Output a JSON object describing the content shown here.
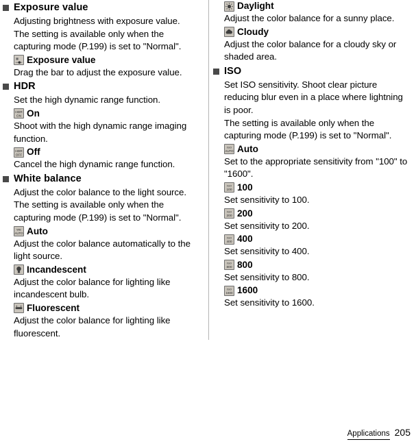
{
  "footer": {
    "section_label": "Applications",
    "page_number": "205"
  },
  "left_column": {
    "sections": [
      {
        "title": "Exposure value",
        "paragraphs": [
          "Adjusting brightness with exposure value.",
          "The setting is available only when the capturing mode (P.199) is set to \"Normal\"."
        ],
        "options": [
          {
            "icon": "exposure-value-icon",
            "label": "Exposure value",
            "desc": "Drag the bar to adjust the exposure value."
          }
        ]
      },
      {
        "title": "HDR",
        "paragraphs": [
          "Set the high dynamic range function."
        ],
        "options": [
          {
            "icon": "hdr-on-icon",
            "label": "On",
            "desc": "Shoot with the high dynamic range imaging function."
          },
          {
            "icon": "hdr-off-icon",
            "label": "Off",
            "desc": "Cancel the high dynamic range function."
          }
        ]
      },
      {
        "title": "White balance",
        "paragraphs": [
          "Adjust the color balance to the light source.",
          "The setting is available only when the capturing mode (P.199) is set to \"Normal\"."
        ],
        "options": [
          {
            "icon": "white-balance-auto-icon",
            "label": "Auto",
            "desc": "Adjust the color balance automatically to the light source."
          },
          {
            "icon": "incandescent-icon",
            "label": "Incandescent",
            "desc": "Adjust the color balance for lighting like incandescent bulb."
          },
          {
            "icon": "fluorescent-icon",
            "label": "Fluorescent",
            "desc": "Adjust the color balance for lighting like fluorescent."
          }
        ]
      }
    ]
  },
  "right_column": {
    "continued_options": [
      {
        "icon": "daylight-icon",
        "label": "Daylight",
        "desc": "Adjust the color balance for a sunny place."
      },
      {
        "icon": "cloudy-icon",
        "label": "Cloudy",
        "desc": "Adjust the color balance for a cloudy sky or shaded area."
      }
    ],
    "sections": [
      {
        "title": "ISO",
        "paragraphs": [
          "Set ISO sensitivity. Shoot clear picture reducing blur even in a place where lightning is poor.",
          "The setting is available only when the capturing mode (P.199) is set to \"Normal\"."
        ],
        "options": [
          {
            "icon": "iso-auto-icon",
            "label": "Auto",
            "desc": "Set to the appropriate sensitivity from \"100\" to \"1600\"."
          },
          {
            "icon": "iso-100-icon",
            "label": "100",
            "desc": "Set sensitivity to 100."
          },
          {
            "icon": "iso-200-icon",
            "label": "200",
            "desc": "Set sensitivity to 200."
          },
          {
            "icon": "iso-400-icon",
            "label": "400",
            "desc": "Set sensitivity to 400."
          },
          {
            "icon": "iso-800-icon",
            "label": "800",
            "desc": "Set sensitivity to 800."
          },
          {
            "icon": "iso-1600-icon",
            "label": "1600",
            "desc": "Set sensitivity to 1600."
          }
        ]
      }
    ]
  }
}
